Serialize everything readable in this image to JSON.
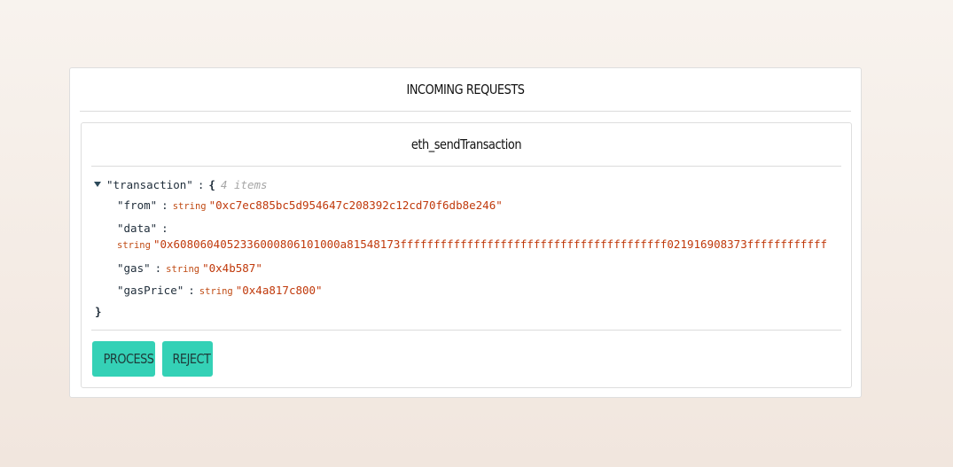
{
  "panel": {
    "title": "INCOMING REQUESTS"
  },
  "request": {
    "method": "eth_sendTransaction",
    "json": {
      "root_key": "\"transaction\"",
      "open_brace": "{",
      "close_brace": "}",
      "item_count": "4 items",
      "fields": [
        {
          "key": "\"from\"",
          "type": "string",
          "value": "\"0xc7ec885bc5d954647c208392c12cd70f6db8e246\""
        },
        {
          "key": "\"data\"",
          "type": "string",
          "value": "\"0x6080604052336000806101000a81548173ffffffffffffffffffffffffffffffffffffffff021916908373ffffffffffff"
        },
        {
          "key": "\"gas\"",
          "type": "string",
          "value": "\"0x4b587\""
        },
        {
          "key": "\"gasPrice\"",
          "type": "string",
          "value": "\"0x4a817c800\""
        }
      ],
      "colon": ":"
    },
    "actions": {
      "process_label": "PROCESS",
      "reject_label": "REJECT"
    }
  }
}
